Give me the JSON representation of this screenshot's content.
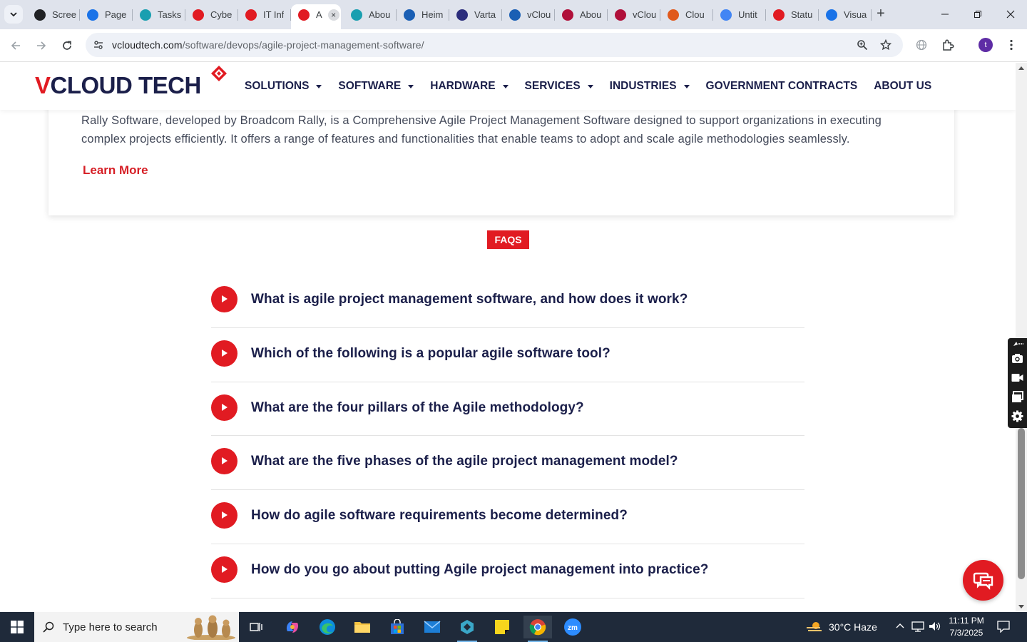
{
  "browser": {
    "tabs": [
      {
        "title": "Scree",
        "icon": "screencast-icon",
        "color": "#202124"
      },
      {
        "title": "Page",
        "icon": "pagespeed-icon",
        "color": "#1a73e8"
      },
      {
        "title": "Tasks",
        "icon": "tasks-icon",
        "color": "#1a9fb0"
      },
      {
        "title": "Cybe",
        "icon": "vcloud-diamond-icon",
        "color": "#e11b22"
      },
      {
        "title": "IT Inf",
        "icon": "vcloud-diamond-icon",
        "color": "#e11b22"
      },
      {
        "title": "A",
        "icon": "vcloud-diamond-icon",
        "color": "#e11b22",
        "active": true
      },
      {
        "title": "Abou",
        "icon": "hexagon-icon",
        "color": "#1a9fb0"
      },
      {
        "title": "Heim",
        "icon": "scales-icon",
        "color": "#1a5fb4"
      },
      {
        "title": "Varta",
        "icon": "varta-x-icon",
        "color": "#2b2d7c"
      },
      {
        "title": "vClou",
        "icon": "checkmark-icon",
        "color": "#1a5fb4"
      },
      {
        "title": "Abou",
        "icon": "bolt-icon",
        "color": "#b0103a"
      },
      {
        "title": "vClou",
        "icon": "v-logo-icon",
        "color": "#b0103a"
      },
      {
        "title": "Clou",
        "icon": "slash-icon",
        "color": "#e0591c"
      },
      {
        "title": "Untit",
        "icon": "docs-icon",
        "color": "#4285f4"
      },
      {
        "title": "Statu",
        "icon": "status-icon",
        "color": "#e11b22"
      },
      {
        "title": "Visua",
        "icon": "pulse-icon",
        "color": "#1a73e8"
      }
    ],
    "url_host": "vcloudtech.com",
    "url_path": "/software/devops/agile-project-management-software/"
  },
  "site": {
    "logo_v": "V",
    "logo_rest": "CLOUD TECH",
    "nav": [
      {
        "label": "SOLUTIONS",
        "dropdown": true
      },
      {
        "label": "SOFTWARE",
        "dropdown": true
      },
      {
        "label": "HARDWARE",
        "dropdown": true
      },
      {
        "label": "SERVICES",
        "dropdown": true
      },
      {
        "label": "INDUSTRIES",
        "dropdown": true
      },
      {
        "label": "GOVERNMENT CONTRACTS",
        "dropdown": false
      },
      {
        "label": "ABOUT US",
        "dropdown": false
      }
    ]
  },
  "card": {
    "text": "Rally Software, developed by Broadcom Rally, is a Comprehensive Agile Project Management Software designed to support organizations in executing complex projects efficiently. It offers a range of features and functionalities that enable teams to adopt and scale agile methodologies seamlessly.",
    "link": "Learn More"
  },
  "faq": {
    "badge": "FAQS",
    "items": [
      "What is agile project management software, and how does it work?",
      "Which of the following is a popular agile software tool?",
      "What are the four pillars of the Agile methodology?",
      "What are the five phases of the agile project management model?",
      "How do agile software requirements become determined?",
      "How do you go about putting Agile project management into practice?"
    ]
  },
  "taskbar": {
    "search_placeholder": "Type here to search",
    "weather": "30°C  Haze",
    "time": "11:11 PM",
    "date": "7/3/2025"
  },
  "colors": {
    "brand_red": "#e11b22",
    "brand_navy": "#1b1f4a"
  }
}
